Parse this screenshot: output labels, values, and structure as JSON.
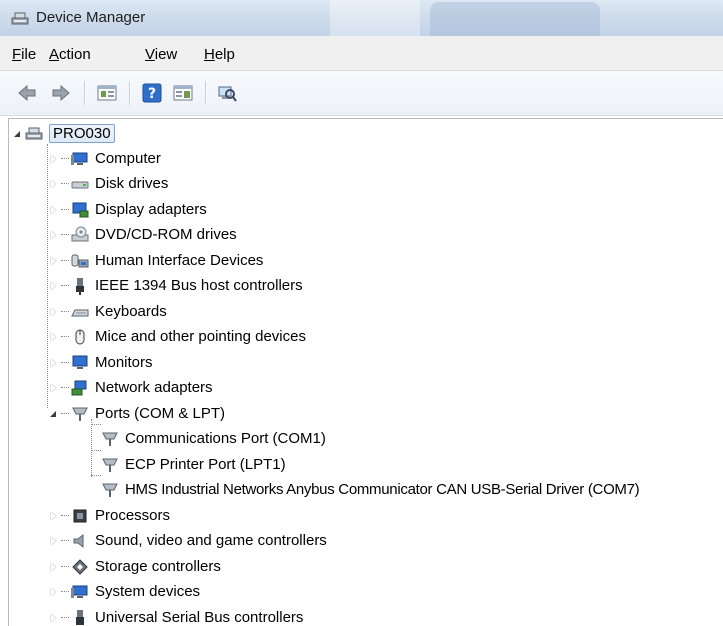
{
  "window": {
    "title": "Device Manager"
  },
  "menu": [
    "File",
    "Action",
    "View",
    "Help"
  ],
  "menu_underline": [
    "F",
    "A",
    "V",
    "H"
  ],
  "toolbar": {
    "buttons": [
      "back-icon",
      "forward-icon",
      "properties-icon",
      "help-icon",
      "console-tree-icon",
      "scan-hardware-icon"
    ]
  },
  "tree": {
    "root": "PRO030",
    "categories": [
      {
        "label": "Computer",
        "icon": "computer-icon",
        "expanded": false
      },
      {
        "label": "Disk drives",
        "icon": "disk-drive-icon",
        "expanded": false
      },
      {
        "label": "Display adapters",
        "icon": "display-adapter-icon",
        "expanded": false
      },
      {
        "label": "DVD/CD-ROM drives",
        "icon": "dvd-drive-icon",
        "expanded": false
      },
      {
        "label": "Human Interface Devices",
        "icon": "hid-icon",
        "expanded": false
      },
      {
        "label": "IEEE 1394 Bus host controllers",
        "icon": "ieee1394-icon",
        "expanded": false
      },
      {
        "label": "Keyboards",
        "icon": "keyboard-icon",
        "expanded": false
      },
      {
        "label": "Mice and other pointing devices",
        "icon": "mouse-icon",
        "expanded": false
      },
      {
        "label": "Monitors",
        "icon": "monitor-icon",
        "expanded": false
      },
      {
        "label": "Network adapters",
        "icon": "network-adapter-icon",
        "expanded": false
      },
      {
        "label": "Ports (COM & LPT)",
        "icon": "port-icon",
        "expanded": true,
        "children": [
          "Communications Port (COM1)",
          "ECP Printer Port (LPT1)",
          "HMS Industrial Networks Anybus Communicator CAN USB-Serial Driver (COM7)"
        ]
      },
      {
        "label": "Processors",
        "icon": "processor-icon",
        "expanded": false
      },
      {
        "label": "Sound, video and game controllers",
        "icon": "sound-icon",
        "expanded": false
      },
      {
        "label": "Storage controllers",
        "icon": "storage-controller-icon",
        "expanded": false
      },
      {
        "label": "System devices",
        "icon": "system-devices-icon",
        "expanded": false
      },
      {
        "label": "Universal Serial Bus controllers",
        "icon": "usb-icon",
        "expanded": false
      }
    ]
  }
}
